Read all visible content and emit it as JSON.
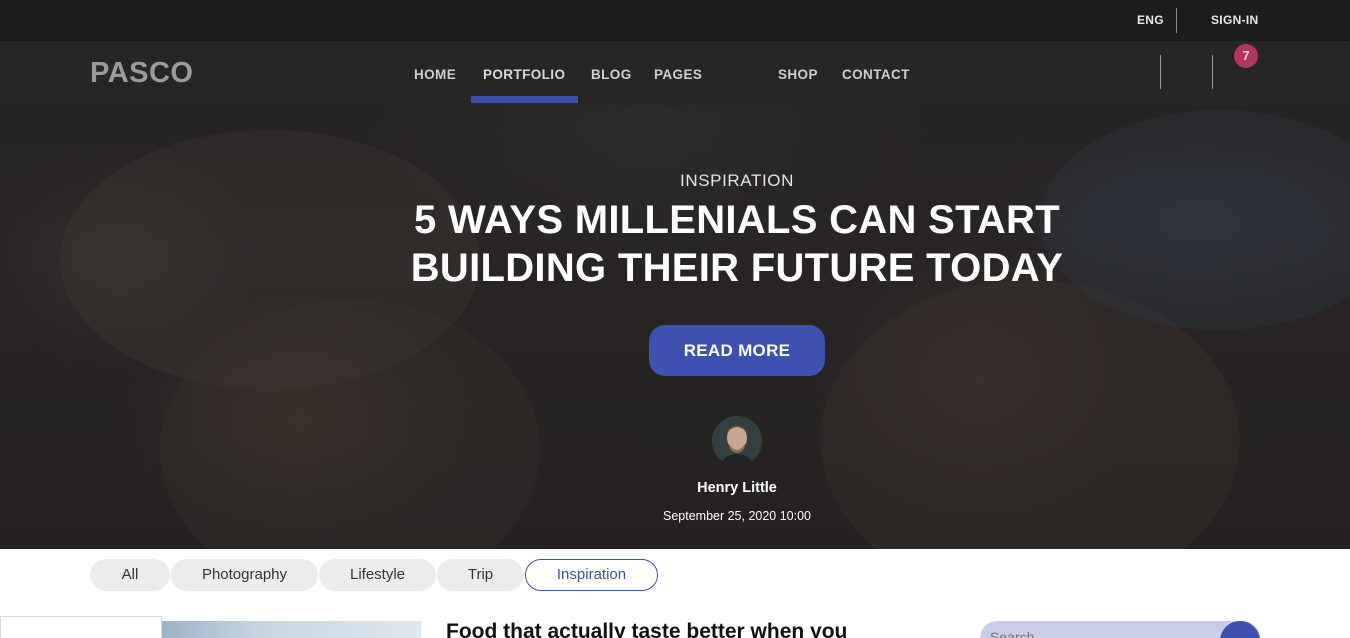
{
  "topbar": {
    "language": "ENG",
    "sign_in": "SIGN-IN"
  },
  "brand": {
    "logo": "PASCO"
  },
  "nav": {
    "items": [
      "HOME",
      "PORTFOLIO",
      "BLOG",
      "PAGES",
      "SHOP",
      "CONTACT"
    ],
    "active": "PORTFOLIO",
    "cart_count": "7"
  },
  "hero": {
    "category": "INSPIRATION",
    "title_line1": "5 WAYS MILLENIALS CAN START",
    "title_line2": "BUILDING THEIR FUTURE TODAY",
    "cta": "READ MORE",
    "author": "Henry Little",
    "date": "September 25, 2020 10:00"
  },
  "filters": {
    "items": [
      "All",
      "Photography",
      "Lifestyle",
      "Trip",
      "Inspiration"
    ],
    "active": "Inspiration"
  },
  "post": {
    "title": "Food that actually taste better when you"
  },
  "search": {
    "placeholder": "Search"
  },
  "colors": {
    "accent": "#3e50b0",
    "badge": "#b0385e",
    "topbar": "#1d1c1c"
  }
}
